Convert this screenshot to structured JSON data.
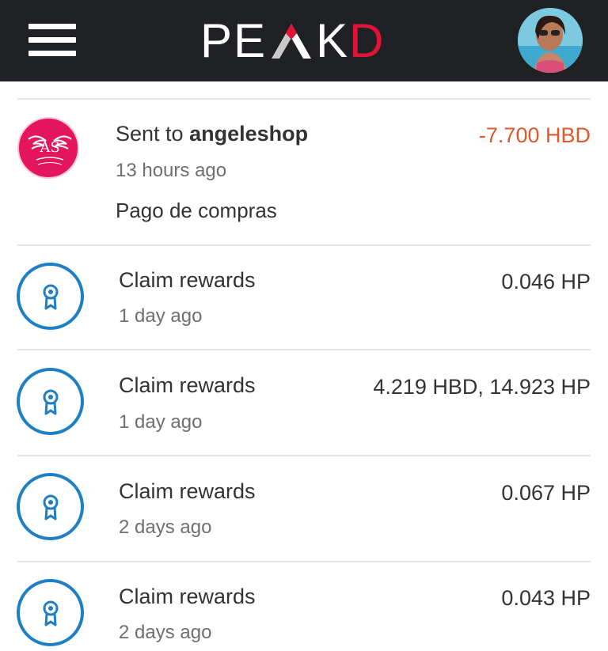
{
  "header": {
    "logo_letters": [
      "P",
      "E",
      "K",
      "D"
    ],
    "menu_icon": "hamburger-menu-icon",
    "avatar_icon": "user-avatar"
  },
  "transactions": [
    {
      "type": "transfer",
      "prefix": "Sent to ",
      "account": "angeleshop",
      "time": "13 hours ago",
      "memo": "Pago de compras",
      "amount": "-7.700 HBD",
      "icon": "angeles-shop-logo"
    },
    {
      "type": "claim",
      "title": "Claim rewards",
      "time": "1 day ago",
      "amount": "0.046 HP",
      "icon": "award-ribbon-icon"
    },
    {
      "type": "claim",
      "title": "Claim rewards",
      "time": "1 day ago",
      "amount": "4.219 HBD, 14.923 HP",
      "icon": "award-ribbon-icon"
    },
    {
      "type": "claim",
      "title": "Claim rewards",
      "time": "2 days ago",
      "amount": "0.067 HP",
      "icon": "award-ribbon-icon"
    },
    {
      "type": "claim",
      "title": "Claim rewards",
      "time": "2 days ago",
      "amount": "0.043 HP",
      "icon": "award-ribbon-icon"
    }
  ],
  "colors": {
    "topbar": "#1f2124",
    "accent_red": "#e31337",
    "negative_amount": "#e0582b",
    "icon_blue": "#1f7fc4"
  }
}
